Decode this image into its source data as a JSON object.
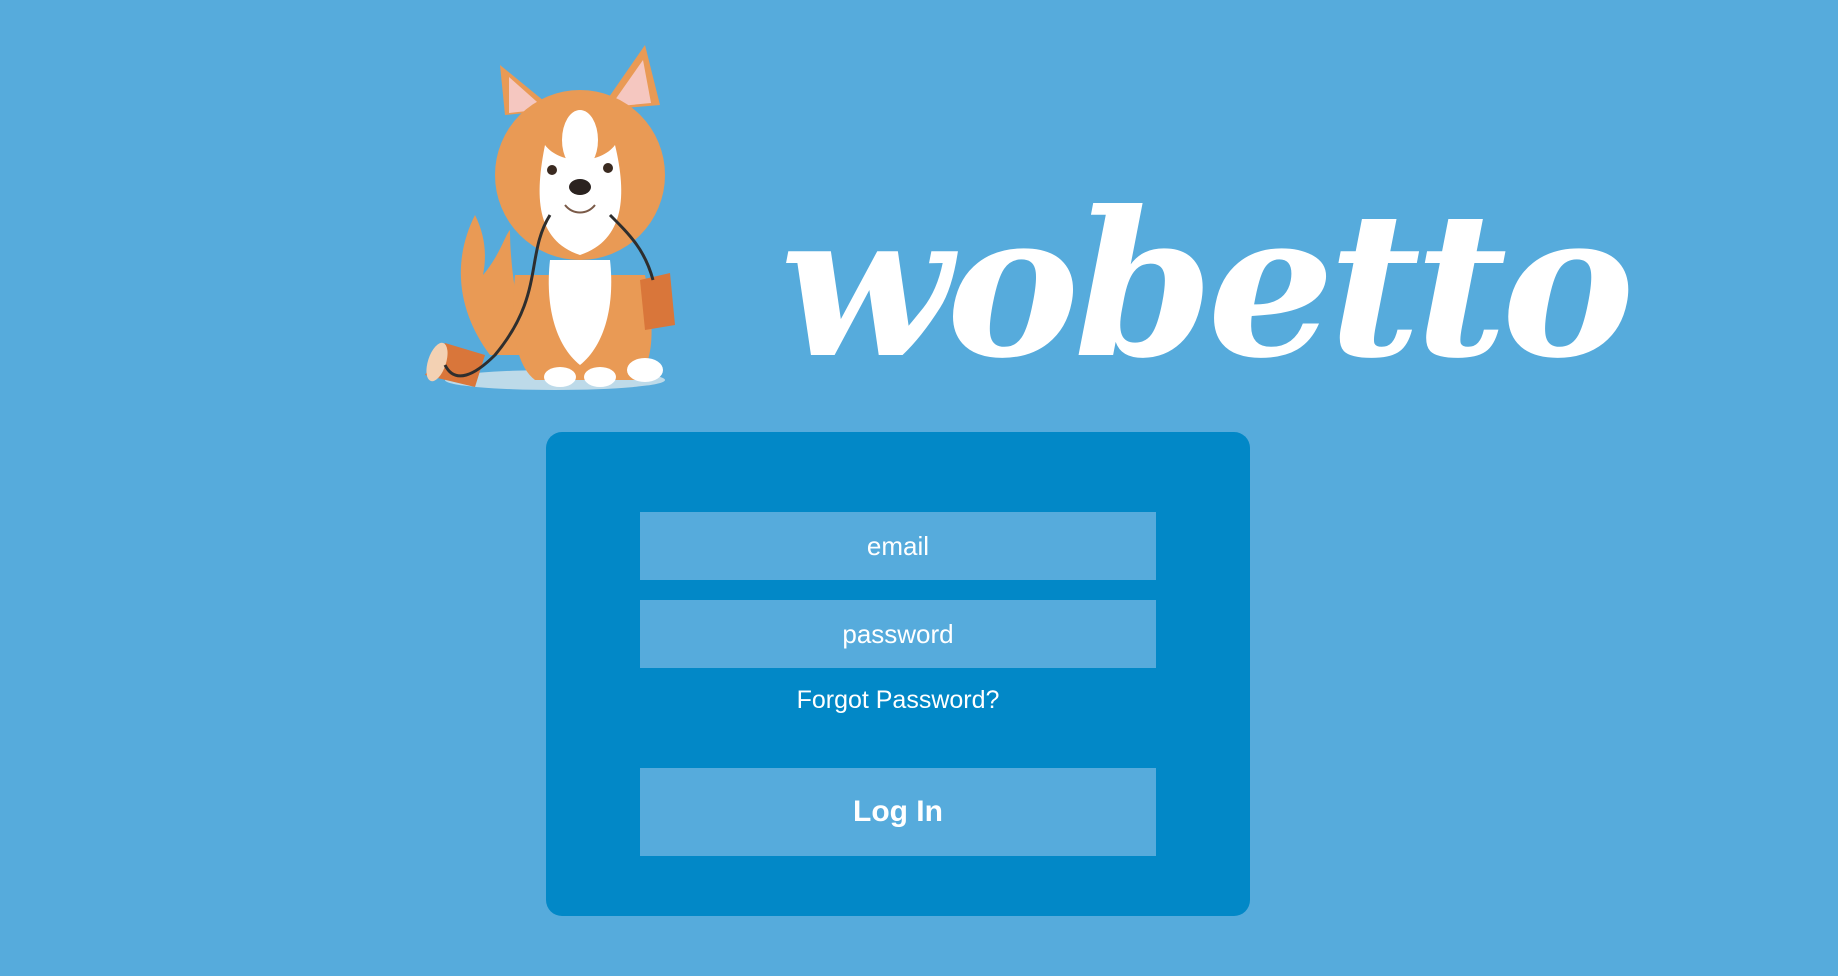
{
  "brand": {
    "wordmark": "wobetto",
    "logo_icon": "corgi-dog-with-string-telephone-illustration"
  },
  "login": {
    "email_placeholder": "email",
    "password_placeholder": "password",
    "forgot_password_label": "Forgot Password?",
    "login_button_label": "Log In"
  },
  "colors": {
    "background": "#56abdc",
    "card": "#0288c7",
    "field": "#56abdc",
    "text": "#ffffff",
    "dog_orange": "#e99a55",
    "dog_white": "#ffffff"
  }
}
